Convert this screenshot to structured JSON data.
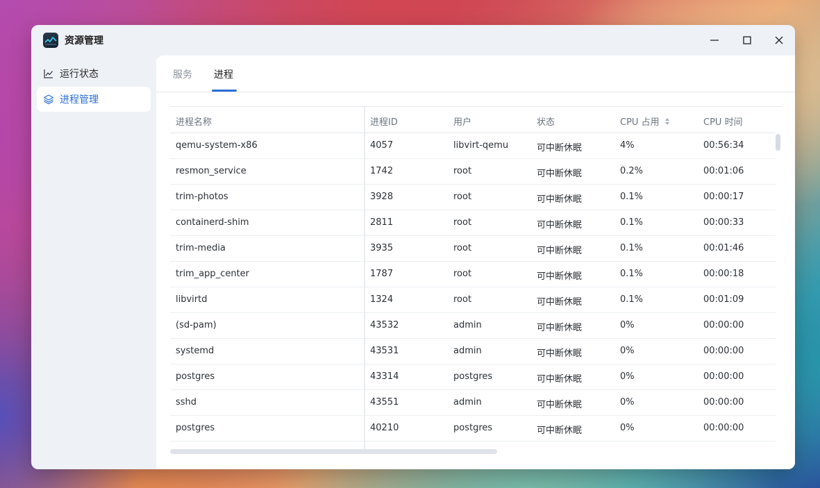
{
  "window": {
    "title": "资源管理",
    "controls": {
      "minimize": "minimize-icon",
      "maximize": "maximize-icon",
      "close": "close-icon"
    }
  },
  "sidebar": {
    "items": [
      {
        "label": "运行状态",
        "icon": "line-chart-icon",
        "active": false
      },
      {
        "label": "进程管理",
        "icon": "layers-icon",
        "active": true
      }
    ]
  },
  "tabs": [
    {
      "label": "服务",
      "active": false
    },
    {
      "label": "进程",
      "active": true
    }
  ],
  "table": {
    "columns": [
      "进程名称",
      "进程ID",
      "用户",
      "状态",
      "CPU 占用",
      "CPU 时间"
    ],
    "sort_column": "CPU 占用",
    "rows": [
      [
        "qemu-system-x86",
        "4057",
        "libvirt-qemu",
        "可中断休眠",
        "4%",
        "00:56:34"
      ],
      [
        "resmon_service",
        "1742",
        "root",
        "可中断休眠",
        "0.2%",
        "00:01:06"
      ],
      [
        "trim-photos",
        "3928",
        "root",
        "可中断休眠",
        "0.1%",
        "00:00:17"
      ],
      [
        "containerd-shim",
        "2811",
        "root",
        "可中断休眠",
        "0.1%",
        "00:00:33"
      ],
      [
        "trim-media",
        "3935",
        "root",
        "可中断休眠",
        "0.1%",
        "00:01:46"
      ],
      [
        "trim_app_center",
        "1787",
        "root",
        "可中断休眠",
        "0.1%",
        "00:00:18"
      ],
      [
        "libvirtd",
        "1324",
        "root",
        "可中断休眠",
        "0.1%",
        "00:01:09"
      ],
      [
        "(sd-pam)",
        "43532",
        "admin",
        "可中断休眠",
        "0%",
        "00:00:00"
      ],
      [
        "systemd",
        "43531",
        "admin",
        "可中断休眠",
        "0%",
        "00:00:00"
      ],
      [
        "postgres",
        "43314",
        "postgres",
        "可中断休眠",
        "0%",
        "00:00:00"
      ],
      [
        "sshd",
        "43551",
        "admin",
        "可中断休眠",
        "0%",
        "00:00:00"
      ],
      [
        "postgres",
        "40210",
        "postgres",
        "可中断休眠",
        "0%",
        "00:00:00"
      ]
    ]
  },
  "colors": {
    "accent": "#2a6fd6",
    "window_bg": "#eef1f6"
  }
}
